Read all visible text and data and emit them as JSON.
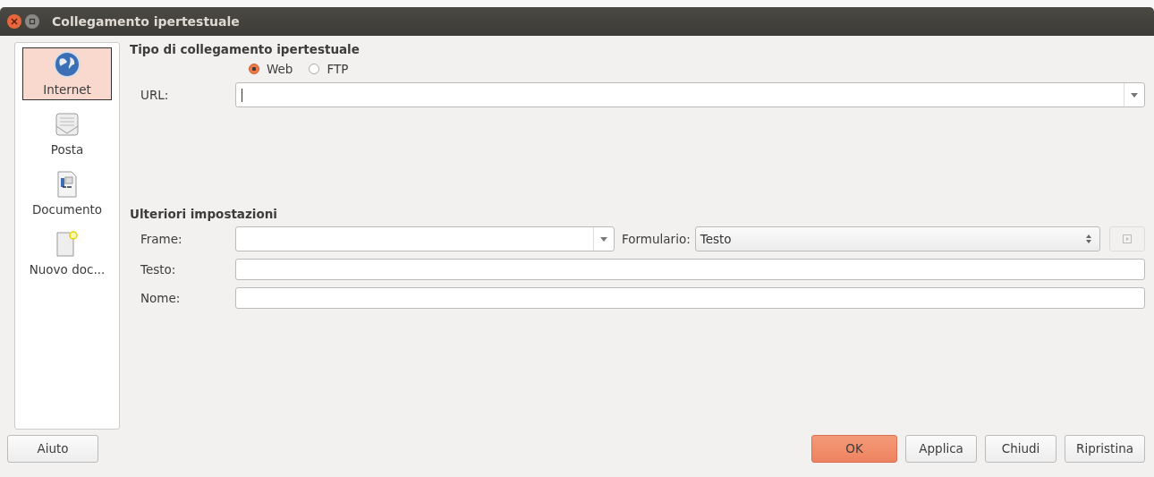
{
  "window": {
    "title": "Collegamento ipertestuale"
  },
  "sidebar": {
    "items": [
      {
        "label": "Internet",
        "kind": "globe",
        "selected": true
      },
      {
        "label": "Posta",
        "kind": "mail",
        "selected": false
      },
      {
        "label": "Documento",
        "kind": "document",
        "selected": false
      },
      {
        "label": "Nuovo doc...",
        "kind": "new",
        "selected": false
      }
    ]
  },
  "link_type": {
    "heading": "Tipo di collegamento ipertestuale",
    "options": [
      {
        "label": "Web",
        "selected": true
      },
      {
        "label": "FTP",
        "selected": false
      }
    ],
    "url_label": "URL:"
  },
  "settings": {
    "heading": "Ulteriori impostazioni",
    "frame_label": "Frame:",
    "form_label": "Formulario:",
    "form_value": "Testo",
    "text_label": "Testo:",
    "name_label": "Nome:"
  },
  "buttons": {
    "help": "Aiuto",
    "actions": [
      {
        "label": "OK",
        "kind": "primary"
      },
      {
        "label": "Applica",
        "kind": "normal"
      },
      {
        "label": "Chiudi",
        "kind": "normal"
      },
      {
        "label": "Ripristina",
        "kind": "normal"
      }
    ]
  }
}
